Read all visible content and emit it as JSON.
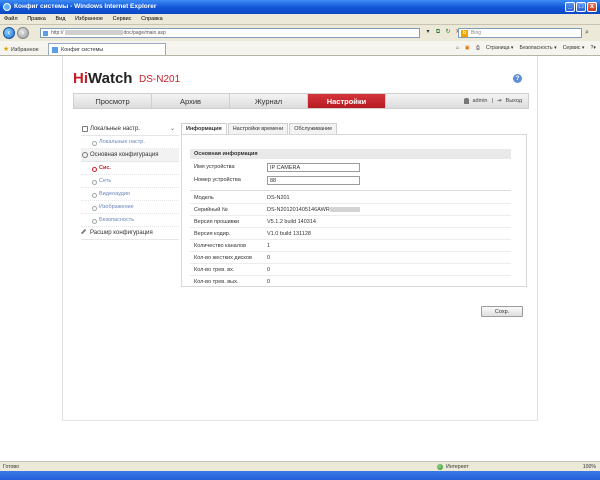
{
  "window": {
    "title": "Конфиг системы - Windows Internet Explorer",
    "minimize": "_",
    "maximize": "□",
    "close": "x"
  },
  "menu": [
    "Файл",
    "Правка",
    "Вид",
    "Избранное",
    "Сервис",
    "Справка"
  ],
  "address": {
    "prefix": "http://",
    "suffix": "doc/page/main.asp",
    "search_placeholder": "Bing"
  },
  "favorites": {
    "label": "Избранное",
    "tab_title": "Конфиг системы",
    "commands": [
      "Страница ▾",
      "Безопасность ▾",
      "Сервис ▾",
      "?▾"
    ]
  },
  "app": {
    "logo_hi": "Hi",
    "logo_rest": "Watch",
    "model": "DS-N201",
    "help": "?",
    "tabs": [
      {
        "label": "Просмотр",
        "active": false
      },
      {
        "label": "Архив",
        "active": false
      },
      {
        "label": "Журнал",
        "active": false
      },
      {
        "label": "Настройки",
        "active": true
      }
    ],
    "user": "admin",
    "logout": "Выход"
  },
  "sidebar": {
    "local": {
      "label": "Локальные настр.",
      "item": "Локальные настр."
    },
    "basic": {
      "label": "Основная конфигурация",
      "items": [
        {
          "label": "Сис.",
          "active": true
        },
        {
          "label": "Сеть",
          "active": false
        },
        {
          "label": "Видеоаудио",
          "active": false
        },
        {
          "label": "Изображение",
          "active": false
        },
        {
          "label": "Безопасность",
          "active": false
        }
      ]
    },
    "advanced": {
      "label": "Расшир конфигурация"
    }
  },
  "subtabs": [
    {
      "label": "Информация",
      "active": true
    },
    {
      "label": "Настройки времени",
      "active": false
    },
    {
      "label": "Обслуживание",
      "active": false
    }
  ],
  "basic_info": {
    "title": "Основная информация",
    "device_name_label": "Имя устройства",
    "device_name_value": "IP CAMERA",
    "device_no_label": "Номер устройства",
    "device_no_value": "88"
  },
  "info_rows": [
    {
      "label": "Модель",
      "value": "DS-N201"
    },
    {
      "label": "Серийный №",
      "value": "DS-N201201405146AWR"
    },
    {
      "label": "Версия прошивки",
      "value": "V5.1.2 build 140314"
    },
    {
      "label": "Версия кодир.",
      "value": "V1.0 build 131128"
    },
    {
      "label": "Количество каналов",
      "value": "1"
    },
    {
      "label": "Кол-во жестких дисков",
      "value": "0"
    },
    {
      "label": "Кол-во трев. вх.",
      "value": "0"
    },
    {
      "label": "Кол-во трев. вых.",
      "value": "0"
    }
  ],
  "save_label": "Сохр.",
  "status": {
    "text": "Готово",
    "zone": "Интернет",
    "zoom": "100%"
  }
}
